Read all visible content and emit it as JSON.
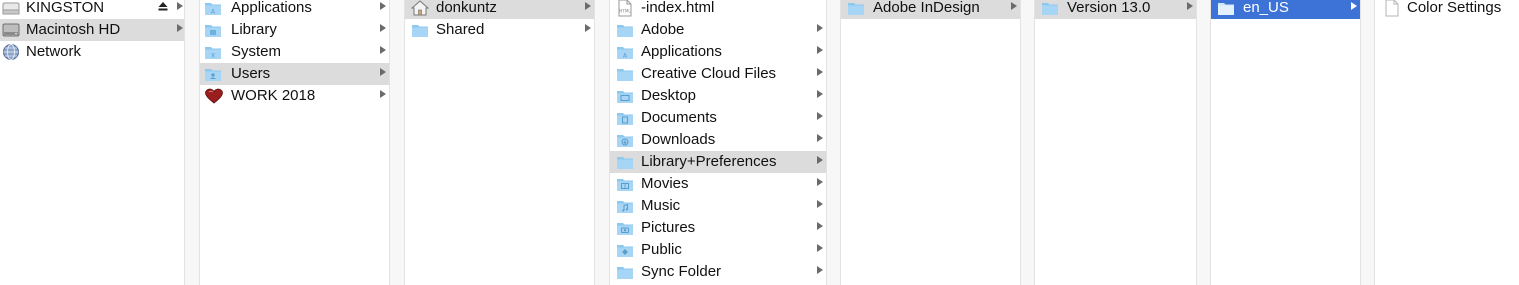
{
  "sidebar": {
    "items": [
      {
        "label": "KINGSTON",
        "icon": "drive-icon",
        "eject": "⏏"
      },
      {
        "label": "Macintosh HD",
        "icon": "hard-drive-icon"
      },
      {
        "label": "Network",
        "icon": "globe-icon"
      }
    ]
  },
  "col1": {
    "items": [
      {
        "label": "Applications",
        "icon": "applications-folder-icon"
      },
      {
        "label": "Library",
        "icon": "library-folder-icon"
      },
      {
        "label": "System",
        "icon": "system-folder-icon"
      },
      {
        "label": "Users",
        "icon": "users-folder-icon"
      },
      {
        "label": "WORK 2018",
        "icon": "heart-drive-icon"
      }
    ]
  },
  "col2": {
    "items": [
      {
        "label": "donkuntz",
        "icon": "home-icon"
      },
      {
        "label": "Shared",
        "icon": "folder-icon"
      }
    ]
  },
  "col3": {
    "items": [
      {
        "label": "-index.html",
        "icon": "html-file-icon"
      },
      {
        "label": "Adobe",
        "icon": "folder-icon"
      },
      {
        "label": "Applications",
        "icon": "applications-folder-icon"
      },
      {
        "label": "Creative Cloud Files",
        "icon": "folder-icon"
      },
      {
        "label": "Desktop",
        "icon": "desktop-folder-icon"
      },
      {
        "label": "Documents",
        "icon": "documents-folder-icon"
      },
      {
        "label": "Downloads",
        "icon": "downloads-folder-icon"
      },
      {
        "label": "Library+Preferences",
        "icon": "folder-icon"
      },
      {
        "label": "Movies",
        "icon": "movies-folder-icon"
      },
      {
        "label": "Music",
        "icon": "music-folder-icon"
      },
      {
        "label": "Pictures",
        "icon": "pictures-folder-icon"
      },
      {
        "label": "Public",
        "icon": "public-folder-icon"
      },
      {
        "label": "Sync Folder",
        "icon": "folder-icon"
      }
    ]
  },
  "col4": {
    "items": [
      {
        "label": "Adobe InDesign",
        "icon": "folder-icon"
      }
    ]
  },
  "col5": {
    "items": [
      {
        "label": "Version 13.0",
        "icon": "folder-icon"
      }
    ]
  },
  "col6": {
    "items": [
      {
        "label": "en_US",
        "icon": "folder-icon"
      }
    ]
  },
  "col7": {
    "items": [
      {
        "label": "Color Settings",
        "icon": "document-icon"
      }
    ]
  },
  "colors": {
    "selection_gray": "#dcdcdc",
    "selection_blue": "#3d73d6",
    "folder_blue": "#8ec8ef"
  }
}
